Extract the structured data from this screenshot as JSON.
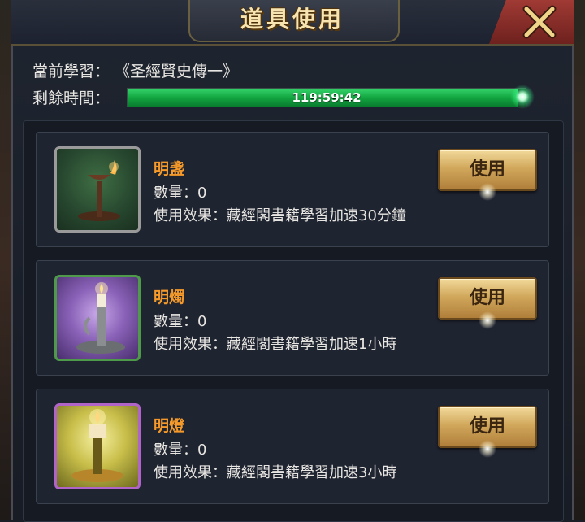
{
  "dialog": {
    "title": "道具使用",
    "current_study_label": "當前學習：",
    "current_study_value": "《圣經賢史傳一》",
    "remaining_time_label": "剩餘時間：",
    "remaining_time_value": "119:59:42",
    "remaining_progress": 0.98
  },
  "items": [
    {
      "name": "明盞",
      "quantity_text": "數量：0",
      "effect_text": "使用效果：藏經閣書籍學習加速30分鐘",
      "button_label": "使用",
      "icon": "oil-lamp-icon"
    },
    {
      "name": "明燭",
      "quantity_text": "數量：0",
      "effect_text": "使用效果：藏經閣書籍學習加速1小時",
      "button_label": "使用",
      "icon": "candlestick-icon"
    },
    {
      "name": "明燈",
      "quantity_text": "數量：0",
      "effect_text": "使用效果：藏經閣書籍學習加速3小時",
      "button_label": "使用",
      "icon": "golden-lamp-icon"
    }
  ],
  "colors": {
    "item_name": "#f59a2a",
    "progress_green": "#12a640",
    "close_button": "#8a2c28"
  }
}
